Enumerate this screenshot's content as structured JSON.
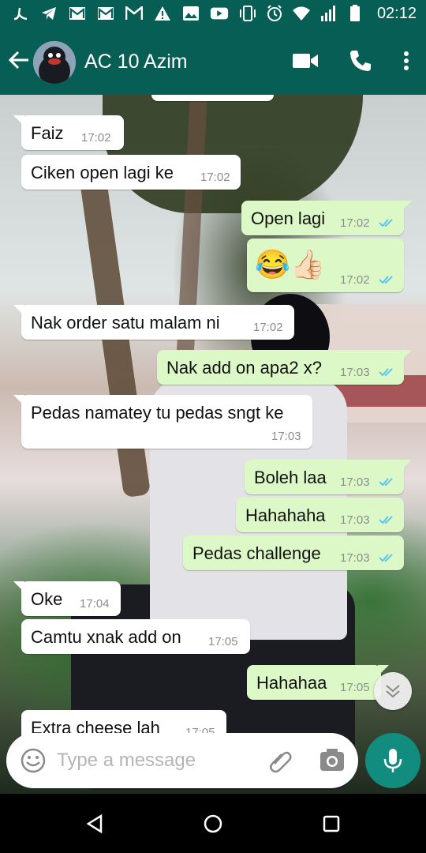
{
  "status_bar": {
    "time": "02:12",
    "icons": [
      "l-logo-icon",
      "telegram-icon",
      "mail-icon",
      "mail-icon",
      "mail-icon",
      "warning-icon",
      "image-icon",
      "youtube-icon",
      "vibrate-icon",
      "alarm-icon",
      "wifi-icon",
      "signal-icon",
      "battery-icon"
    ]
  },
  "header": {
    "contact_name": "AC 10 Azim",
    "icons": [
      "back-arrow-icon",
      "video-call-icon",
      "phone-icon",
      "more-icon"
    ]
  },
  "messages": [
    {
      "dir": "in",
      "text": "Faiz",
      "time": "17:02"
    },
    {
      "dir": "in",
      "text": "Ciken open lagi ke",
      "time": "17:02"
    },
    {
      "dir": "out",
      "text": "Open lagi",
      "time": "17:02",
      "status": "read"
    },
    {
      "dir": "out",
      "text": "😂👍🏻",
      "time": "17:02",
      "status": "read"
    },
    {
      "dir": "in",
      "text": "Nak order satu malam ni",
      "time": "17:02"
    },
    {
      "dir": "out",
      "text": "Nak add on apa2 x?",
      "time": "17:03",
      "status": "read"
    },
    {
      "dir": "in",
      "text": "Pedas namatey tu pedas sngt ke",
      "time": "17:03"
    },
    {
      "dir": "out",
      "text": "Boleh laa",
      "time": "17:03",
      "status": "read"
    },
    {
      "dir": "out",
      "text": "Hahahaha",
      "time": "17:03",
      "status": "read"
    },
    {
      "dir": "out",
      "text": "Pedas challenge",
      "time": "17:03",
      "status": "read"
    },
    {
      "dir": "in",
      "text": "Oke",
      "time": "17:04"
    },
    {
      "dir": "in",
      "text": "Camtu xnak add on",
      "time": "17:05"
    },
    {
      "dir": "out",
      "text": "Hahahaa",
      "time": "17:05"
    },
    {
      "dir": "in",
      "text": "Extra cheese lah",
      "time": "17:05"
    }
  ],
  "composer": {
    "placeholder": "Type a message"
  },
  "colors": {
    "header": "#075E54",
    "outgoing_bubble": "#dcf8c6",
    "incoming_bubble": "#ffffff",
    "read_ticks": "#4fc3f7",
    "mic_button": "#128C7E"
  }
}
